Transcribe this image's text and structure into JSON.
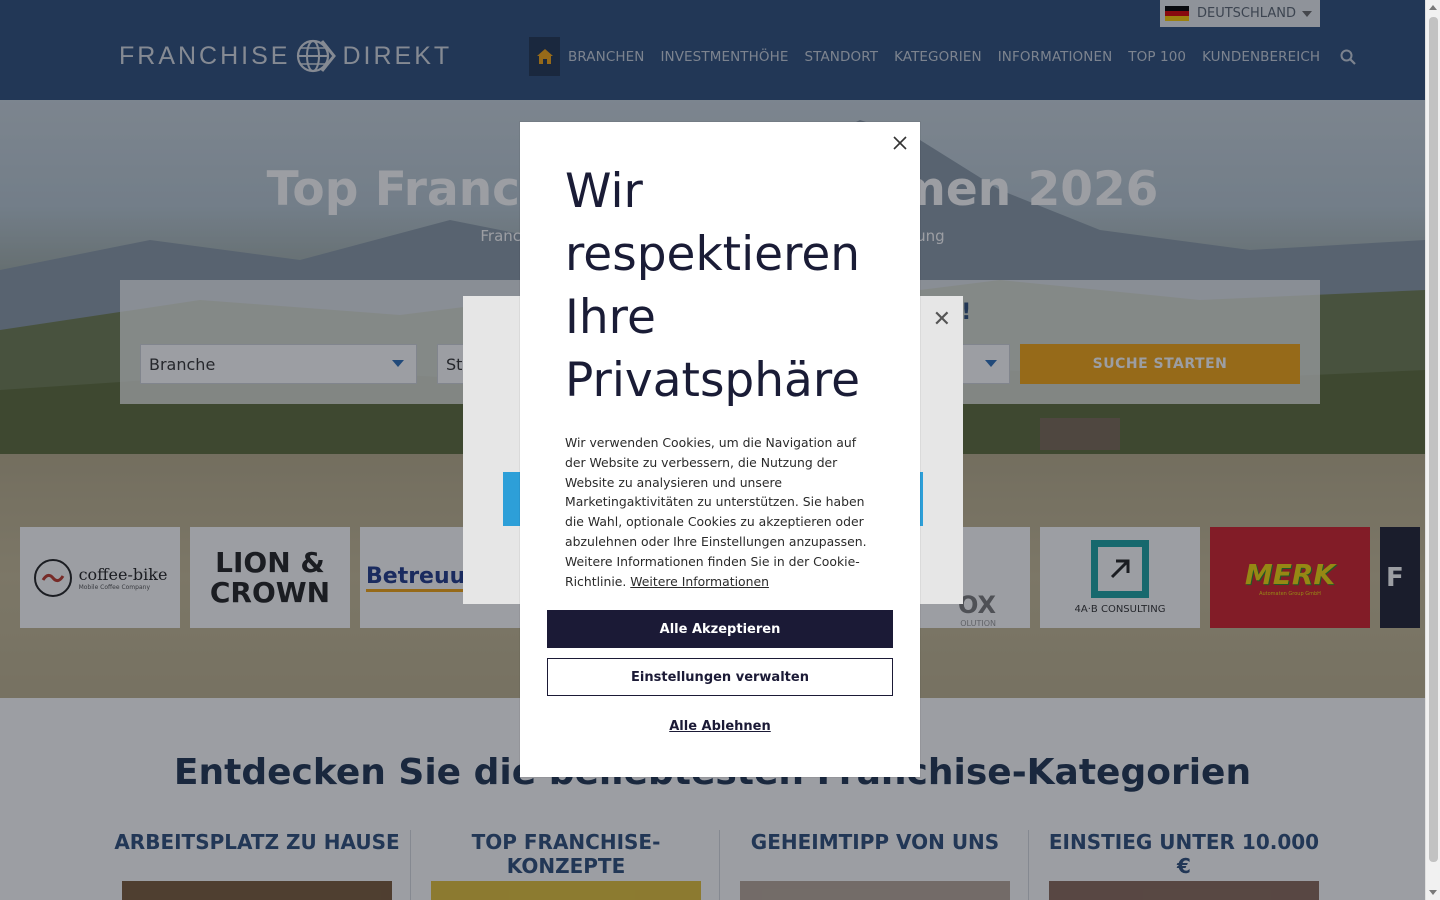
{
  "header": {
    "language": "DEUTSCHLAND",
    "logo_left": "FRANCHISE",
    "logo_right": "DIREKT",
    "nav": [
      "BRANCHEN",
      "INVESTMENTHÖHE",
      "STANDORT",
      "KATEGORIEN",
      "INFORMATIONEN",
      "TOP 100",
      "KUNDENBEREICH"
    ]
  },
  "hero": {
    "title": "Top Franchise-Unternehmen 2026",
    "subtitle": "Franchise-Systeme und Lizenzkonzepte zur Existenzgründung",
    "search_question": "Über 600 Franchise-Systeme entdecken!",
    "select_branche": "Branche",
    "select_standort": "Standort",
    "search_button": "SUCHE STARTEN"
  },
  "logos": {
    "coffee_bike": "coffee-bike",
    "coffee_bike_sub": "Mobile Coffee Company",
    "lion_crown_1": "LION &",
    "lion_crown_2": "CROWN",
    "betreuung": "Betreuung",
    "box": "OX",
    "box_sub": "OLUTION",
    "consulting": "4A·B CONSULTING",
    "merk": "MERK",
    "merk_sub": "Automaten Group GmbH",
    "partial": "F"
  },
  "categories": {
    "title": "Entdecken Sie die beliebtesten Franchise-Kategorien",
    "items": [
      "ARBEITSPLATZ ZU HAUSE",
      "TOP FRANCHISE-KONZEPTE",
      "GEHEIMTIPP VON UNS",
      "EINSTIEG UNTER 10.000 €"
    ]
  },
  "cookie": {
    "title": "Wir respektieren Ihre Privatsphäre",
    "body": "Wir verwenden Cookies, um die Navigation auf der Website zu verbessern, die Nutzung der Website zu analysieren und unsere Marketingaktivitäten zu unterstützen. Sie haben die Wahl, optionale Cookies zu akzeptieren oder abzulehnen oder Ihre Einstellungen anzupassen. Weitere Informationen finden Sie in der Cookie-Richtlinie.",
    "more_link": "Weitere Informationen",
    "accept_all": "Alle Akzeptieren",
    "manage": "Einstellungen verwalten",
    "reject_all": "Alle Ablehnen"
  },
  "colors": {
    "header_bg": "#2e4f7a",
    "accent_orange": "#f4a512",
    "cookie_dark": "#1b1a36"
  }
}
